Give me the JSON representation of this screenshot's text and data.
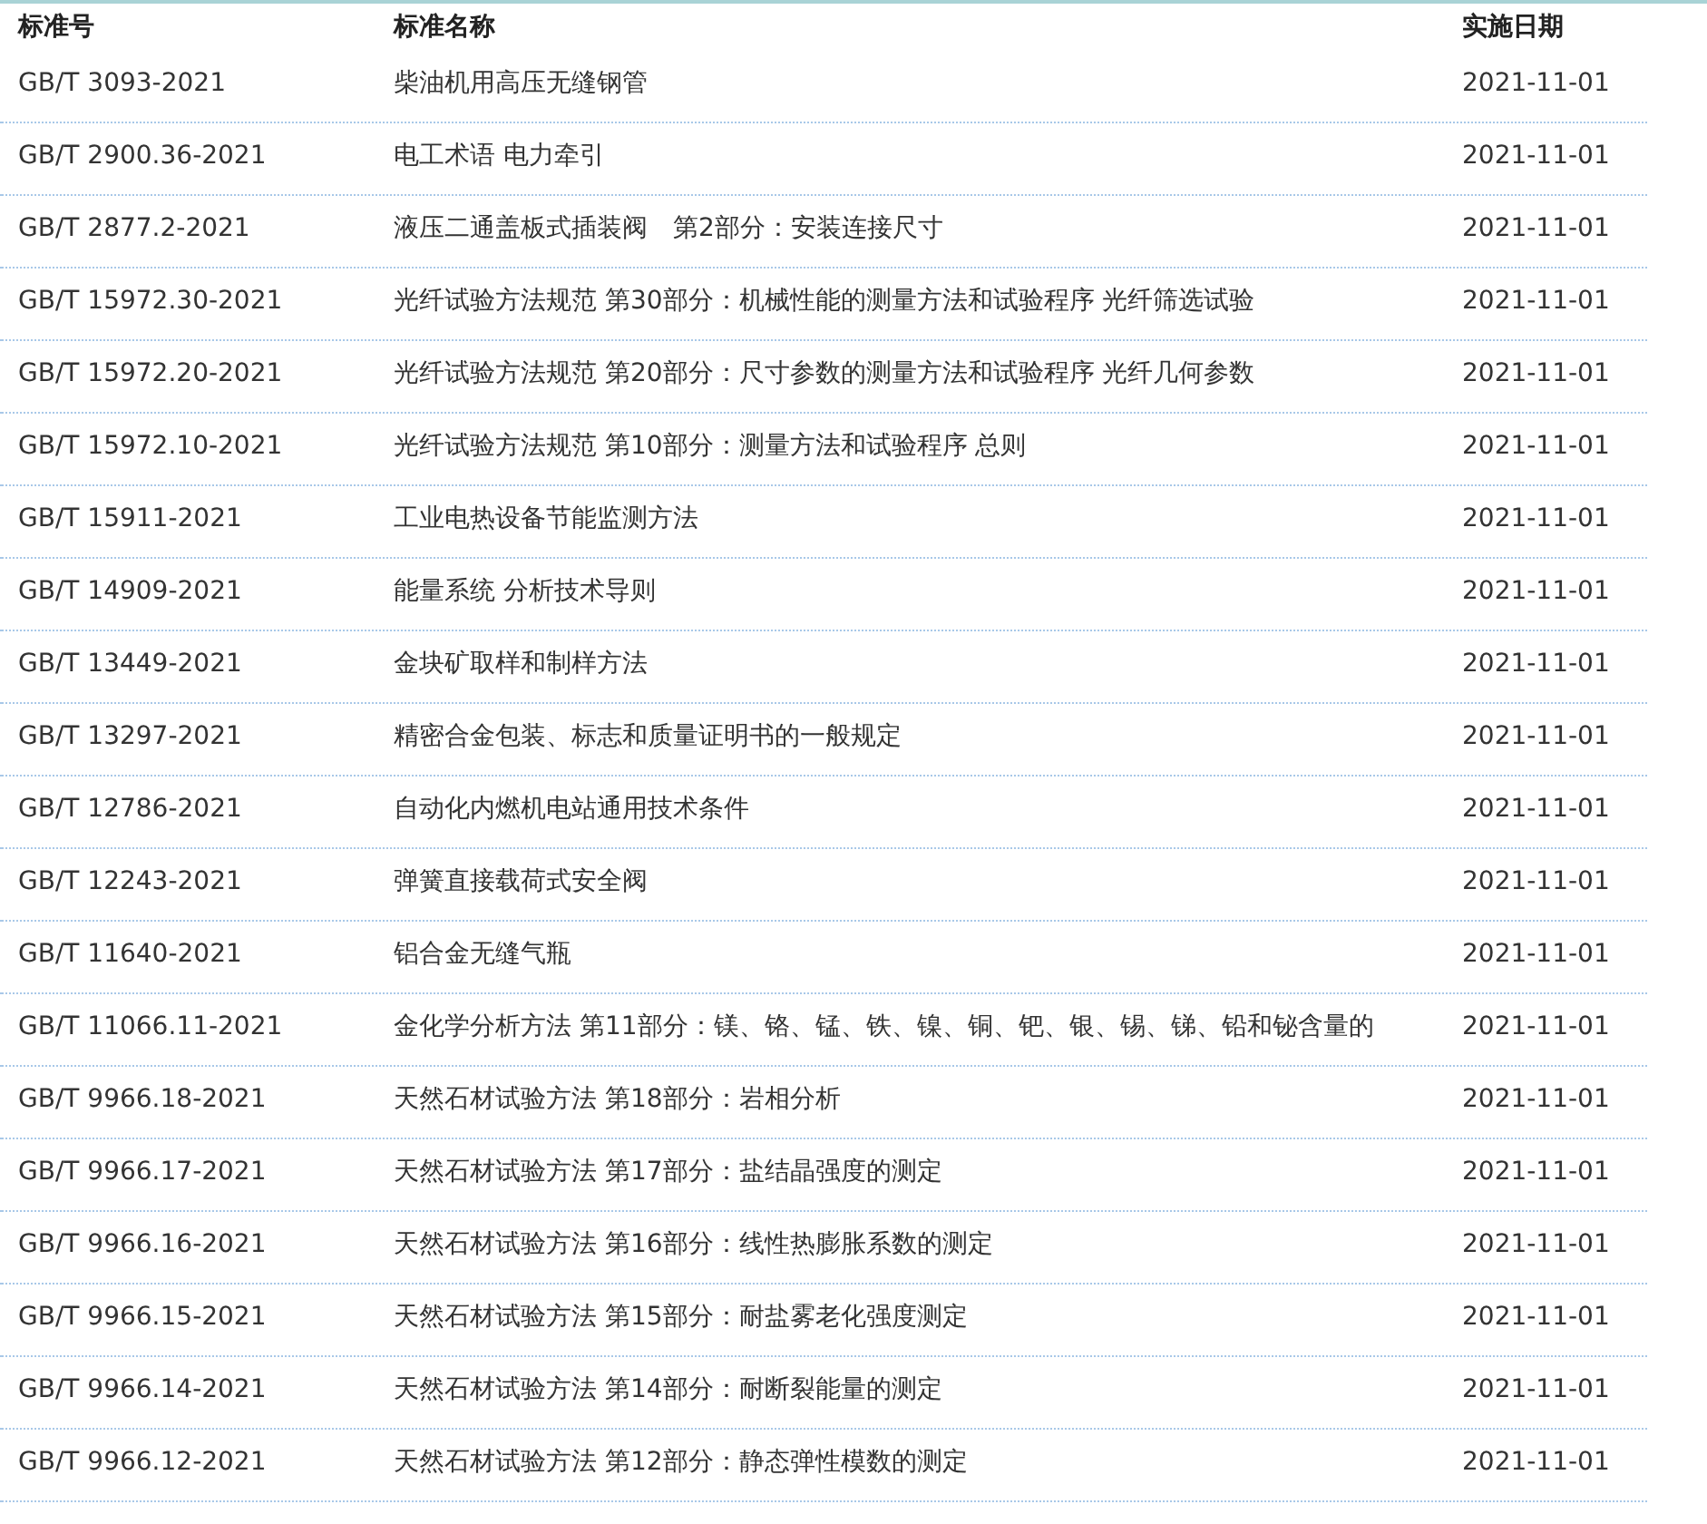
{
  "table": {
    "columns": [
      "标准号",
      "标准名称",
      "实施日期"
    ],
    "rows": [
      {
        "code": "GB/T 3093-2021",
        "name": "柴油机用高压无缝钢管",
        "date": "2021-11-01"
      },
      {
        "code": "GB/T 2900.36-2021",
        "name": "电工术语 电力牵引",
        "date": "2021-11-01"
      },
      {
        "code": "GB/T 2877.2-2021",
        "name": "液压二通盖板式插装阀　第2部分：安装连接尺寸",
        "date": "2021-11-01"
      },
      {
        "code": "GB/T 15972.30-2021",
        "name": "光纤试验方法规范 第30部分：机械性能的测量方法和试验程序 光纤筛选试验",
        "date": "2021-11-01"
      },
      {
        "code": "GB/T 15972.20-2021",
        "name": "光纤试验方法规范 第20部分：尺寸参数的测量方法和试验程序 光纤几何参数",
        "date": "2021-11-01"
      },
      {
        "code": "GB/T 15972.10-2021",
        "name": "光纤试验方法规范 第10部分：测量方法和试验程序 总则",
        "date": "2021-11-01"
      },
      {
        "code": "GB/T 15911-2021",
        "name": "工业电热设备节能监测方法",
        "date": "2021-11-01"
      },
      {
        "code": "GB/T 14909-2021",
        "name": "能量系统 分析技术导则",
        "date": "2021-11-01"
      },
      {
        "code": "GB/T 13449-2021",
        "name": "金块矿取样和制样方法",
        "date": "2021-11-01"
      },
      {
        "code": "GB/T 13297-2021",
        "name": "精密合金包装、标志和质量证明书的一般规定",
        "date": "2021-11-01"
      },
      {
        "code": "GB/T 12786-2021",
        "name": "自动化内燃机电站通用技术条件",
        "date": "2021-11-01"
      },
      {
        "code": "GB/T 12243-2021",
        "name": "弹簧直接载荷式安全阀",
        "date": "2021-11-01"
      },
      {
        "code": "GB/T 11640-2021",
        "name": "铝合金无缝气瓶",
        "date": "2021-11-01"
      },
      {
        "code": "GB/T 11066.11-2021",
        "name": "金化学分析方法 第11部分：镁、铬、锰、铁、镍、铜、钯、银、锡、锑、铅和铋含量的",
        "date": "2021-11-01"
      },
      {
        "code": "GB/T 9966.18-2021",
        "name": "天然石材试验方法 第18部分：岩相分析",
        "date": "2021-11-01"
      },
      {
        "code": "GB/T 9966.17-2021",
        "name": "天然石材试验方法 第17部分：盐结晶强度的测定",
        "date": "2021-11-01"
      },
      {
        "code": "GB/T 9966.16-2021",
        "name": "天然石材试验方法 第16部分：线性热膨胀系数的测定",
        "date": "2021-11-01"
      },
      {
        "code": "GB/T 9966.15-2021",
        "name": "天然石材试验方法 第15部分：耐盐雾老化强度测定",
        "date": "2021-11-01"
      },
      {
        "code": "GB/T 9966.14-2021",
        "name": "天然石材试验方法 第14部分：耐断裂能量的测定",
        "date": "2021-11-01"
      },
      {
        "code": "GB/T 9966.12-2021",
        "name": "天然石材试验方法 第12部分：静态弹性模数的测定",
        "date": "2021-11-01"
      }
    ]
  }
}
